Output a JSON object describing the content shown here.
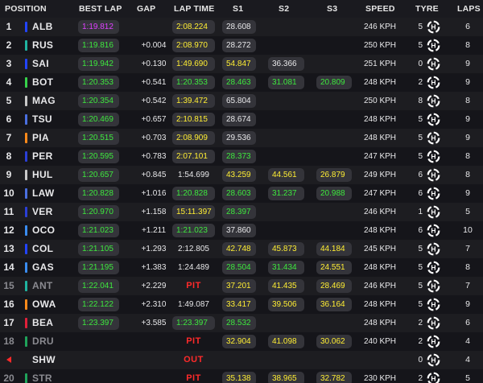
{
  "headers": {
    "position": "POSITION",
    "best_lap": "BEST LAP",
    "gap": "GAP",
    "lap_time": "LAP TIME",
    "s1": "S1",
    "s2": "S2",
    "s3": "S3",
    "speed": "SPEED",
    "tyre": "TYRE",
    "laps": "LAPS"
  },
  "colors": {
    "green": "#3ee83e",
    "yellow": "#ffee33",
    "purple": "#e040ff",
    "white": "#e8e8ea",
    "red": "#ff2a2a",
    "grey": "#8a8a90",
    "tyre_icon": "#ffffff"
  },
  "tyre_icon": "hard-tyre-icon",
  "rows": [
    {
      "pos": "1",
      "driver": "ALB",
      "team": "#2244ff",
      "best": "1:19.812",
      "best_c": "p",
      "gap": "",
      "lap": "2:08.224",
      "lap_c": "y",
      "s1": "28.608",
      "s1_c": "w",
      "s2": "",
      "s2_c": "w",
      "s3": "",
      "s3_c": "w",
      "speed": "246 KPH",
      "tyre": "5",
      "laps": "6",
      "state": "normal"
    },
    {
      "pos": "2",
      "driver": "RUS",
      "team": "#1fb4a0",
      "best": "1:19.816",
      "best_c": "g",
      "gap": "+0.004",
      "lap": "2:08.970",
      "lap_c": "y",
      "s1": "28.272",
      "s1_c": "w",
      "s2": "",
      "s2_c": "w",
      "s3": "",
      "s3_c": "w",
      "speed": "250 KPH",
      "tyre": "5",
      "laps": "8",
      "state": "normal"
    },
    {
      "pos": "3",
      "driver": "SAI",
      "team": "#2244ff",
      "best": "1:19.942",
      "best_c": "g",
      "gap": "+0.130",
      "lap": "1:49.690",
      "lap_c": "y",
      "s1": "54.847",
      "s1_c": "y",
      "s2": "36.366",
      "s2_c": "w",
      "s3": "",
      "s3_c": "w",
      "speed": "251 KPH",
      "tyre": "0",
      "laps": "9",
      "state": "normal"
    },
    {
      "pos": "4",
      "driver": "BOT",
      "team": "#36d14a",
      "best": "1:20.353",
      "best_c": "g",
      "gap": "+0.541",
      "lap": "1:20.353",
      "lap_c": "g",
      "s1": "28.463",
      "s1_c": "g",
      "s2": "31.081",
      "s2_c": "g",
      "s3": "20.809",
      "s3_c": "g",
      "speed": "248 KPH",
      "tyre": "2",
      "laps": "9",
      "state": "normal"
    },
    {
      "pos": "5",
      "driver": "MAG",
      "team": "#c9c9c9",
      "best": "1:20.354",
      "best_c": "g",
      "gap": "+0.542",
      "lap": "1:39.472",
      "lap_c": "y",
      "s1": "65.804",
      "s1_c": "w",
      "s2": "",
      "s2_c": "w",
      "s3": "",
      "s3_c": "w",
      "speed": "250 KPH",
      "tyre": "8",
      "laps": "8",
      "state": "normal"
    },
    {
      "pos": "6",
      "driver": "TSU",
      "team": "#4a6fe0",
      "best": "1:20.469",
      "best_c": "g",
      "gap": "+0.657",
      "lap": "2:10.815",
      "lap_c": "y",
      "s1": "28.674",
      "s1_c": "w",
      "s2": "",
      "s2_c": "w",
      "s3": "",
      "s3_c": "w",
      "speed": "248 KPH",
      "tyre": "5",
      "laps": "9",
      "state": "normal"
    },
    {
      "pos": "7",
      "driver": "PIA",
      "team": "#ff8a1a",
      "best": "1:20.515",
      "best_c": "g",
      "gap": "+0.703",
      "lap": "2:08.909",
      "lap_c": "y",
      "s1": "29.536",
      "s1_c": "w",
      "s2": "",
      "s2_c": "w",
      "s3": "",
      "s3_c": "w",
      "speed": "248 KPH",
      "tyre": "5",
      "laps": "9",
      "state": "normal"
    },
    {
      "pos": "8",
      "driver": "PER",
      "team": "#2a3fd6",
      "best": "1:20.595",
      "best_c": "g",
      "gap": "+0.783",
      "lap": "2:07.101",
      "lap_c": "y",
      "s1": "28.373",
      "s1_c": "g",
      "s2": "",
      "s2_c": "w",
      "s3": "",
      "s3_c": "w",
      "speed": "247 KPH",
      "tyre": "5",
      "laps": "8",
      "state": "normal"
    },
    {
      "pos": "9",
      "driver": "HUL",
      "team": "#c9c9c9",
      "best": "1:20.657",
      "best_c": "g",
      "gap": "+0.845",
      "lap": "1:54.699",
      "lap_c": "w",
      "s1": "43.259",
      "s1_c": "y",
      "s2": "44.561",
      "s2_c": "y",
      "s3": "26.879",
      "s3_c": "y",
      "speed": "249 KPH",
      "tyre": "6",
      "laps": "8",
      "state": "normal"
    },
    {
      "pos": "10",
      "driver": "LAW",
      "team": "#4a6fe0",
      "best": "1:20.828",
      "best_c": "g",
      "gap": "+1.016",
      "lap": "1:20.828",
      "lap_c": "g",
      "s1": "28.603",
      "s1_c": "g",
      "s2": "31.237",
      "s2_c": "g",
      "s3": "20.988",
      "s3_c": "g",
      "speed": "247 KPH",
      "tyre": "6",
      "laps": "9",
      "state": "normal"
    },
    {
      "pos": "11",
      "driver": "VER",
      "team": "#2a3fd6",
      "best": "1:20.970",
      "best_c": "g",
      "gap": "+1.158",
      "lap": "15:11.397",
      "lap_c": "y",
      "s1": "28.397",
      "s1_c": "g",
      "s2": "",
      "s2_c": "w",
      "s3": "",
      "s3_c": "w",
      "speed": "246 KPH",
      "tyre": "1",
      "laps": "5",
      "state": "normal"
    },
    {
      "pos": "12",
      "driver": "OCO",
      "team": "#3a8cf0",
      "best": "1:21.023",
      "best_c": "g",
      "gap": "+1.211",
      "lap": "1:21.023",
      "lap_c": "g",
      "s1": "37.860",
      "s1_c": "w",
      "s2": "",
      "s2_c": "w",
      "s3": "",
      "s3_c": "w",
      "speed": "248 KPH",
      "tyre": "6",
      "laps": "10",
      "state": "normal"
    },
    {
      "pos": "13",
      "driver": "COL",
      "team": "#2244ff",
      "best": "1:21.105",
      "best_c": "g",
      "gap": "+1.293",
      "lap": "2:12.805",
      "lap_c": "w",
      "s1": "42.748",
      "s1_c": "y",
      "s2": "45.873",
      "s2_c": "y",
      "s3": "44.184",
      "s3_c": "y",
      "speed": "245 KPH",
      "tyre": "5",
      "laps": "7",
      "state": "normal"
    },
    {
      "pos": "14",
      "driver": "GAS",
      "team": "#3a8cf0",
      "best": "1:21.195",
      "best_c": "g",
      "gap": "+1.383",
      "lap": "1:24.489",
      "lap_c": "w",
      "s1": "28.504",
      "s1_c": "g",
      "s2": "31.434",
      "s2_c": "g",
      "s3": "24.551",
      "s3_c": "y",
      "speed": "248 KPH",
      "tyre": "5",
      "laps": "8",
      "state": "normal"
    },
    {
      "pos": "15",
      "driver": "ANT",
      "team": "#1fb4a0",
      "best": "1:22.041",
      "best_c": "g",
      "gap": "+2.229",
      "lap": "PIT",
      "lap_c": "r",
      "s1": "37.201",
      "s1_c": "y",
      "s2": "41.435",
      "s2_c": "y",
      "s3": "28.469",
      "s3_c": "y",
      "speed": "246 KPH",
      "tyre": "5",
      "laps": "7",
      "state": "dim"
    },
    {
      "pos": "16",
      "driver": "OWA",
      "team": "#ff8a1a",
      "best": "1:22.122",
      "best_c": "g",
      "gap": "+2.310",
      "lap": "1:49.087",
      "lap_c": "w",
      "s1": "33.417",
      "s1_c": "y",
      "s2": "39.506",
      "s2_c": "y",
      "s3": "36.164",
      "s3_c": "y",
      "speed": "248 KPH",
      "tyre": "5",
      "laps": "9",
      "state": "normal"
    },
    {
      "pos": "17",
      "driver": "BEA",
      "team": "#e0203a",
      "best": "1:23.397",
      "best_c": "g",
      "gap": "+3.585",
      "lap": "1:23.397",
      "lap_c": "g",
      "s1": "28.532",
      "s1_c": "g",
      "s2": "",
      "s2_c": "w",
      "s3": "",
      "s3_c": "w",
      "speed": "248 KPH",
      "tyre": "2",
      "laps": "6",
      "state": "normal"
    },
    {
      "pos": "18",
      "driver": "DRU",
      "team": "#1fa35a",
      "best": "",
      "best_c": "g",
      "gap": "",
      "lap": "PIT",
      "lap_c": "r",
      "s1": "32.904",
      "s1_c": "y",
      "s2": "41.098",
      "s2_c": "y",
      "s3": "30.062",
      "s3_c": "y",
      "speed": "240 KPH",
      "tyre": "2",
      "laps": "4",
      "state": "dim"
    },
    {
      "pos": "",
      "driver": "SHW",
      "team": "",
      "best": "",
      "best_c": "g",
      "gap": "",
      "lap": "OUT",
      "lap_c": "r",
      "s1": "",
      "s1_c": "w",
      "s2": "",
      "s2_c": "w",
      "s3": "",
      "s3_c": "w",
      "speed": "",
      "tyre": "0",
      "laps": "4",
      "state": "out"
    },
    {
      "pos": "20",
      "driver": "STR",
      "team": "#1fa35a",
      "best": "",
      "best_c": "g",
      "gap": "",
      "lap": "PIT",
      "lap_c": "r",
      "s1": "35.138",
      "s1_c": "y",
      "s2": "38.965",
      "s2_c": "y",
      "s3": "32.782",
      "s3_c": "y",
      "speed": "230 KPH",
      "tyre": "2",
      "laps": "5",
      "state": "dim"
    }
  ]
}
